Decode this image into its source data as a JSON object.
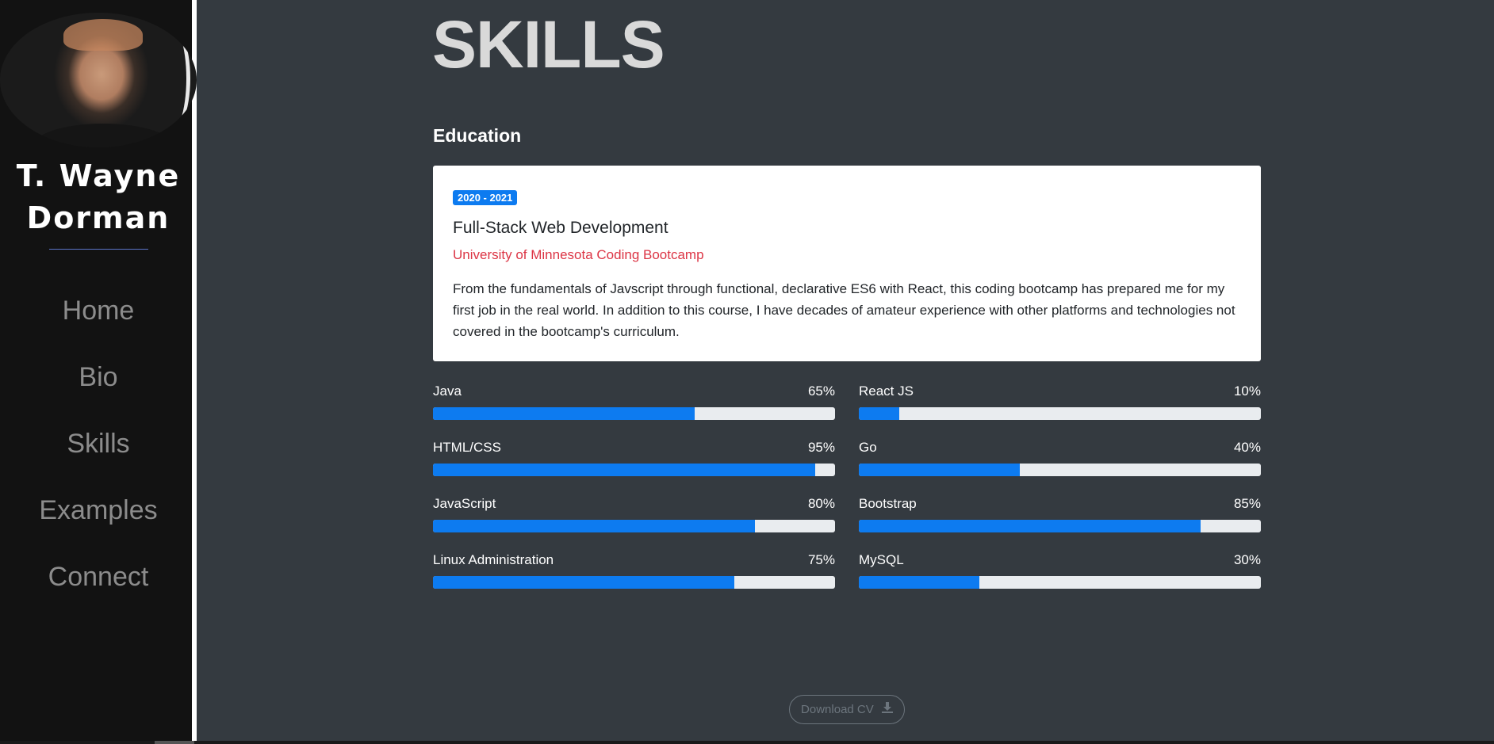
{
  "sidebar": {
    "name_line1": "T. Wayne",
    "name_line2": "Dorman",
    "nav": [
      {
        "label": "Home"
      },
      {
        "label": "Bio"
      },
      {
        "label": "Skills"
      },
      {
        "label": "Examples"
      },
      {
        "label": "Connect"
      }
    ]
  },
  "main": {
    "title": "SKILLS",
    "section_heading": "Education",
    "education": {
      "badge": "2020 - 2021",
      "course": "Full-Stack Web Development",
      "school": "University of Minnesota Coding Bootcamp",
      "description": "From the fundamentals of Javscript through functional, declarative ES6 with React, this coding bootcamp has prepared me for my first job in the real world. In addition to this course, I have decades of amateur experience with other platforms and technologies not covered in the bootcamp's curriculum."
    },
    "skills": [
      {
        "name": "Java",
        "percent_label": "65%",
        "percent": 65
      },
      {
        "name": "React JS",
        "percent_label": "10%",
        "percent": 10
      },
      {
        "name": "HTML/CSS",
        "percent_label": "95%",
        "percent": 95
      },
      {
        "name": "Go",
        "percent_label": "40%",
        "percent": 40
      },
      {
        "name": "JavaScript",
        "percent_label": "80%",
        "percent": 80
      },
      {
        "name": "Bootstrap",
        "percent_label": "85%",
        "percent": 85
      },
      {
        "name": "Linux Administration",
        "percent_label": "75%",
        "percent": 75
      },
      {
        "name": "MySQL",
        "percent_label": "30%",
        "percent": 30
      }
    ],
    "download_label": "Download CV",
    "download_icon": "download-icon"
  },
  "colors": {
    "accent": "#0d7bf0",
    "school_text": "#dc3545",
    "background": "#343a40",
    "sidebar": "#121212"
  }
}
